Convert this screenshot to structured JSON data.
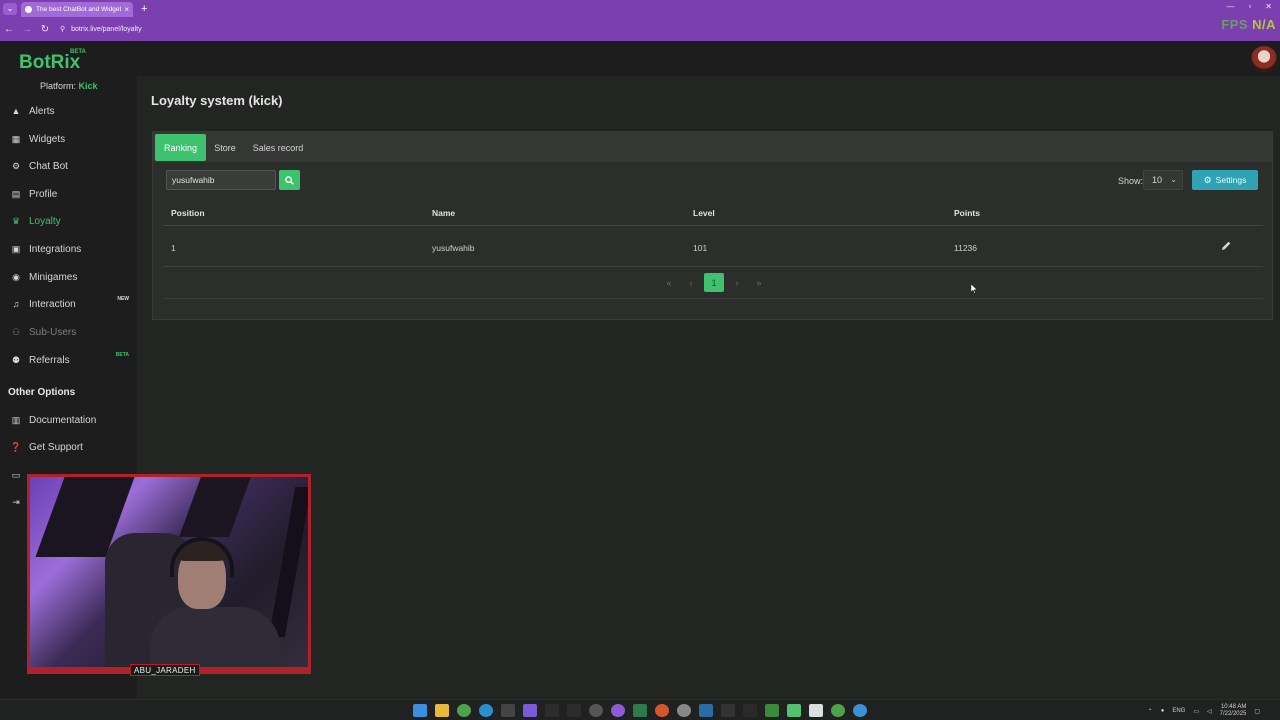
{
  "browser": {
    "tab_title": "The best ChatBot and Widgets",
    "url": "botrix.live/panel/loyalty",
    "overlay_fps_label": "FPS",
    "overlay_fps_value": "N/A"
  },
  "header": {
    "logo": "BotRix",
    "logo_badge": "BETA"
  },
  "sidebar": {
    "platform_label": "Platform:",
    "platform_value": "Kick",
    "items": [
      {
        "label": "Alerts",
        "icon": "warning-icon"
      },
      {
        "label": "Widgets",
        "icon": "grid-icon"
      },
      {
        "label": "Chat Bot",
        "icon": "robot-icon"
      },
      {
        "label": "Profile",
        "icon": "id-card-icon"
      },
      {
        "label": "Loyalty",
        "icon": "trophy-icon",
        "active": true
      },
      {
        "label": "Integrations",
        "icon": "plug-icon"
      },
      {
        "label": "Minigames",
        "icon": "gamepad-icon"
      },
      {
        "label": "Interaction",
        "icon": "music-icon",
        "tag": "NEW"
      },
      {
        "label": "Sub-Users",
        "icon": "users-icon",
        "disabled": true
      },
      {
        "label": "Referrals",
        "icon": "group-icon",
        "tag": "BETA"
      }
    ],
    "other_options_title": "Other Options",
    "other_items": [
      {
        "label": "Documentation",
        "icon": "book-icon"
      },
      {
        "label": "Get Support",
        "icon": "question-icon"
      }
    ]
  },
  "main": {
    "title": "Loyalty system (kick)",
    "tabs": [
      "Ranking",
      "Store",
      "Sales record"
    ],
    "active_tab": "Ranking",
    "search_value": "yusufwahib",
    "show_label": "Show:",
    "show_value": "10",
    "settings_label": "Settings",
    "table": {
      "headers": [
        "Position",
        "Name",
        "Level",
        "Points"
      ],
      "rows": [
        {
          "position": "1",
          "name": "yusufwahib",
          "level": "101",
          "points": "11236"
        }
      ]
    },
    "pagination": {
      "first": "«",
      "prev": "‹",
      "current": "1",
      "next": "›",
      "last": "»"
    }
  },
  "webcam": {
    "label": "ABU_JARADEH"
  },
  "taskbar": {
    "lang": "ENG",
    "time": "10:48 AM",
    "date": "7/22/2025"
  },
  "colors": {
    "accent": "#3fc26f",
    "browser": "#7c3fb0",
    "settings": "#2fa3b4",
    "webcam_border": "#b0222a"
  }
}
